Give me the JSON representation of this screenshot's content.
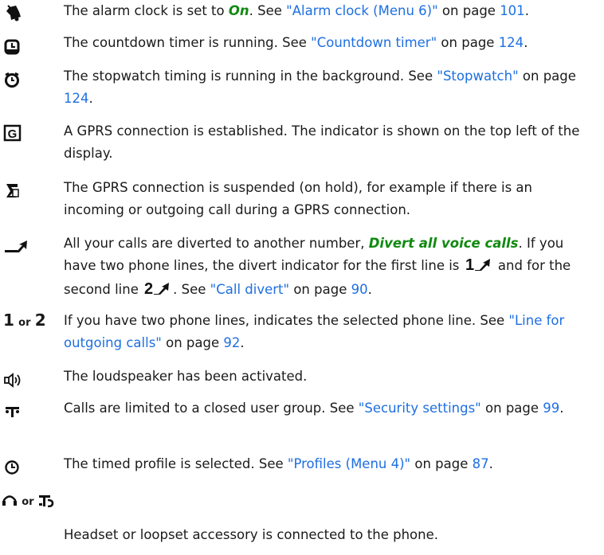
{
  "rows": {
    "alarm": {
      "icon": "alarm-bell-icon",
      "text_a": "The alarm clock is set to ",
      "opt": "On",
      "text_b": ". See ",
      "link": "\"Alarm clock (Menu 6)\"",
      "text_c": " on page ",
      "page": "101",
      "text_d": "."
    },
    "countdown": {
      "icon": "countdown-timer-icon",
      "text_a": "The countdown timer is running. See ",
      "link": "\"Countdown timer\"",
      "text_b": " on page ",
      "page": "124",
      "text_c": "."
    },
    "stopwatch": {
      "icon": "stopwatch-icon",
      "text_a": "The stopwatch timing is running in the background. See ",
      "link": "\"Stopwatch\"",
      "text_b": " on page ",
      "page": "124",
      "text_c": "."
    },
    "gprs": {
      "icon": "gprs-connected-icon",
      "glyph": "G",
      "text_a": "A GPRS connection is established. The indicator is shown on the top left of the display."
    },
    "gprs_hold": {
      "icon": "gprs-suspended-icon",
      "text_a": "The GPRS connection is suspended (on hold), for example if there is an incoming or outgoing call during a GPRS connection."
    },
    "divert": {
      "icon": "call-divert-icon",
      "text_a": "All your calls are diverted to another number, ",
      "opt": "Divert all voice calls",
      "text_b": ". If you have two phone lines, the divert indicator for the first line is ",
      "line1": "1",
      "text_c": " and for the second line ",
      "line2": "2",
      "text_d": ". See ",
      "link": "\"Call divert\"",
      "text_e": " on page ",
      "page": "90",
      "text_f": "."
    },
    "lines": {
      "icon_a": "1",
      "or": "or",
      "icon_b": "2",
      "text_a": "If you have two phone lines, indicates the selected phone line. See ",
      "link": "\"Line for outgoing calls\"",
      "text_b": " on page ",
      "page": "92",
      "text_c": "."
    },
    "speaker": {
      "icon": "loudspeaker-icon",
      "text_a": "The loudspeaker has been activated."
    },
    "cug": {
      "icon": "closed-user-group-icon",
      "text_a": "Calls are limited to a closed user group. See ",
      "link": "\"Security settings\"",
      "text_b": " on page ",
      "page": "99",
      "text_c": "."
    },
    "timed": {
      "icon": "timed-profile-icon",
      "text_a": "The timed profile is selected. See ",
      "link": "\"Profiles (Menu 4)\"",
      "text_b": " on page ",
      "page": "87",
      "text_c": "."
    },
    "headset": {
      "icon_a": "headset-icon",
      "or": "or",
      "icon_b": "loopset-icon",
      "text_a": "Headset or loopset accessory is connected to the phone."
    }
  }
}
